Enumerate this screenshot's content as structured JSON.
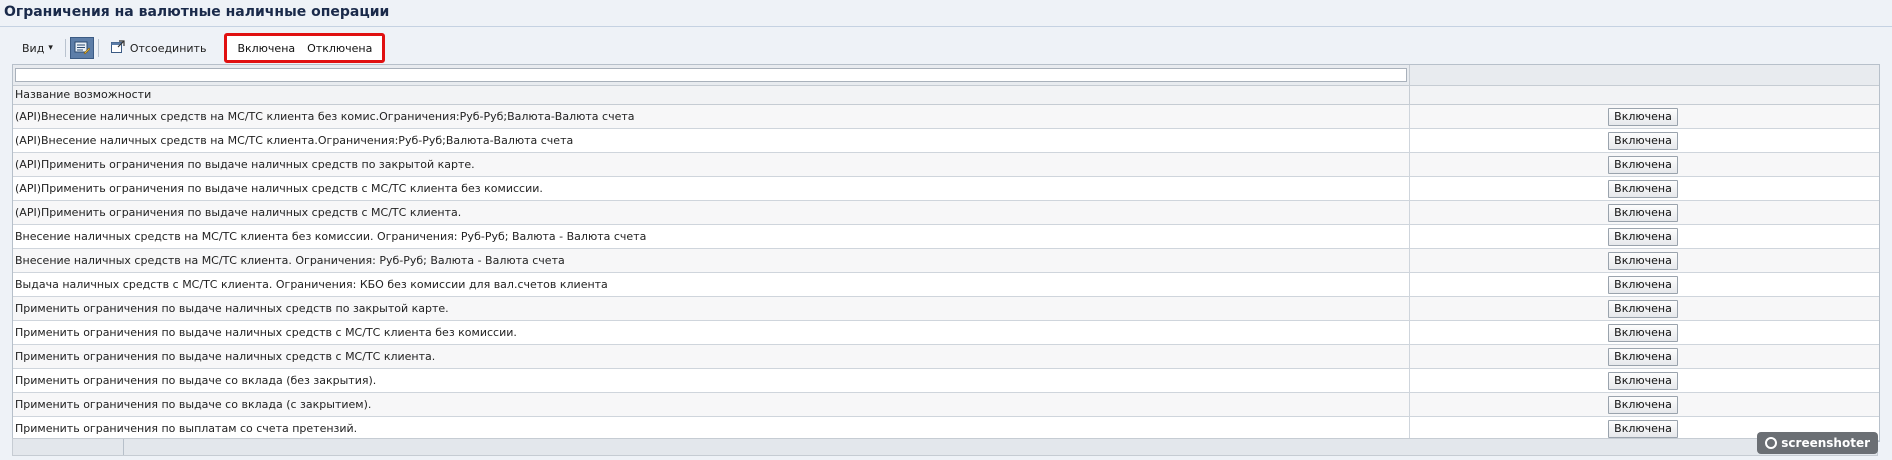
{
  "page": {
    "title": "Ограничения на валютные наличные операции"
  },
  "toolbar": {
    "view_label": "Вид",
    "view_caret": "▾",
    "detach_label": "Отсоединить",
    "enabled_label": "Включена",
    "disabled_label": "Отключена"
  },
  "grid": {
    "filter_value": "",
    "column_header": "Название возможности",
    "rows": [
      {
        "name": "(API)Внесение наличных средств на МС/ТС клиента без комис.Ограничения:Руб-Руб;Валюта-Валюта счета",
        "action": "Включена"
      },
      {
        "name": "(API)Внесение наличных средств на МС/ТС клиента.Ограничения:Руб-Руб;Валюта-Валюта счета",
        "action": "Включена"
      },
      {
        "name": "(API)Применить ограничения по выдаче наличных средств по закрытой карте.",
        "action": "Включена"
      },
      {
        "name": "(API)Применить ограничения по выдаче наличных средств с МС/ТС клиента без комиссии.",
        "action": "Включена"
      },
      {
        "name": "(API)Применить ограничения по выдаче наличных средств с МС/ТС клиента.",
        "action": "Включена"
      },
      {
        "name": "Внесение наличных средств на МС/ТС клиента без комиссии. Ограничения: Руб-Руб; Валюта - Валюта счета",
        "action": "Включена"
      },
      {
        "name": "Внесение наличных средств на МС/ТС клиента. Ограничения: Руб-Руб; Валюта - Валюта счета",
        "action": "Включена"
      },
      {
        "name": "Выдача наличных средств с МС/ТС клиента. Ограничения: КБО без комиссии для вал.счетов клиента",
        "action": "Включена"
      },
      {
        "name": "Применить ограничения по выдаче наличных средств по закрытой карте.",
        "action": "Включена"
      },
      {
        "name": "Применить ограничения по выдаче наличных средств с МС/ТС клиента без комиссии.",
        "action": "Включена"
      },
      {
        "name": "Применить ограничения по выдаче наличных средств с МС/ТС клиента.",
        "action": "Включена"
      },
      {
        "name": "Применить ограничения по выдаче со вклада (без закрытия).",
        "action": "Включена"
      },
      {
        "name": "Применить ограничения по выдаче со вклада (с закрытием).",
        "action": "Включена"
      },
      {
        "name": "Применить ограничения по выплатам со счета претензий.",
        "action": "Включена"
      }
    ]
  },
  "watermark": {
    "text": "screenshoter"
  }
}
